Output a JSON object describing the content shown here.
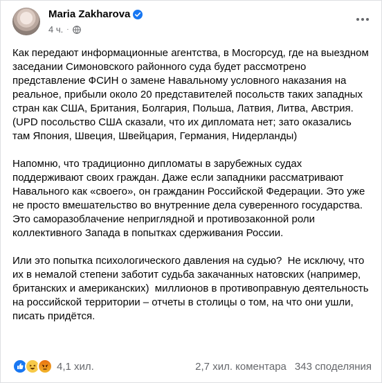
{
  "author": {
    "name": "Maria Zakharova",
    "timestamp": "4 ч."
  },
  "post": {
    "paragraphs": [
      "Как передают информационные агентства, в Мосгорсуд, где на выездном заседании Симоновского районного суда будет рассмотрено представление ФСИН о замене Навальному условного наказания на реальное, прибыли около 20 представителей посольств таких западных стран как США, Британия, Болгария, Польша, Латвия, Литва, Австрия. (UPD посольство США сказали, что их дипломата нет; зато оказались там Япония, Швеция, Швейцария, Германия, Нидерланды)",
      "Напомню, что традиционно дипломаты в зарубежных судах поддерживают своих граждан. Даже если западники рассматривают Навального как «своего», он гражданин Российской Федерации. Это уже не просто вмешательство во внутренние дела суверенного государства. Это саморазоблачение неприглядной и противозаконной роли коллективного Запада в попытках сдерживания России.",
      "Или это попытка психологического давления на судью?  Не исключу, что их в немалой степени заботит судьба закачанных натовских (например, британских и американских)  миллионов в противоправную деятельность на российской территории – отчеты в столицы о том, на что они ушли, писать придётся."
    ]
  },
  "footer": {
    "reactions_count": "4,1 хил.",
    "comments": "2,7 хил. коментара",
    "shares": "343 споделяния"
  },
  "icons": {
    "reactions": [
      "like-icon",
      "haha-icon",
      "angry-icon"
    ],
    "verified": "verified-icon",
    "audience": "globe-icon"
  },
  "colors": {
    "accent": "#1877f2",
    "secondary_text": "#65676b"
  }
}
